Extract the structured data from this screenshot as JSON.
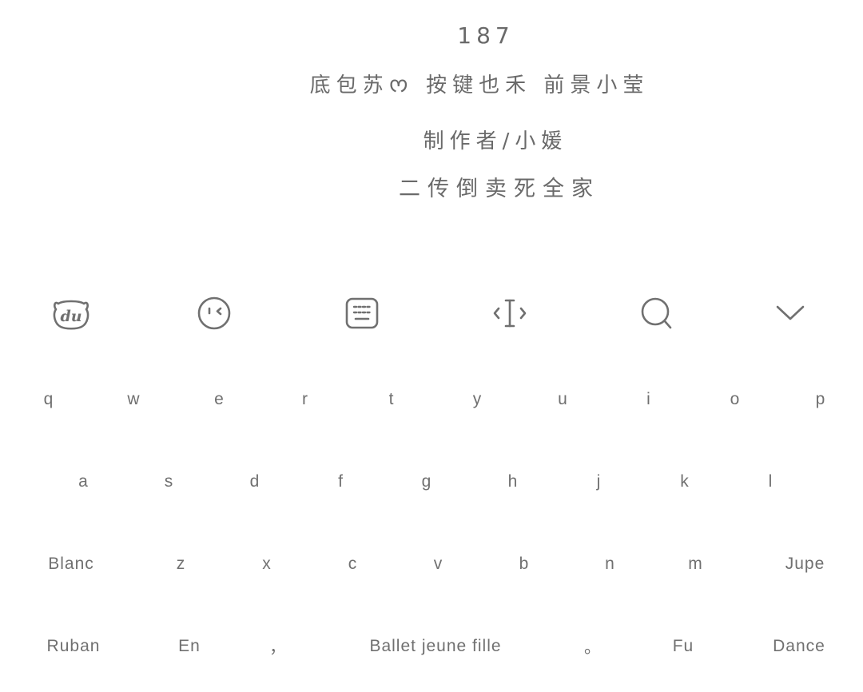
{
  "header": {
    "number": "187",
    "credits": "底包苏ᰔ 按键也禾 前景小莹",
    "author": "制作者/小媛",
    "note": "二传倒卖死全家"
  },
  "toolbar": {
    "items": [
      {
        "icon": "du-bear-logo-icon"
      },
      {
        "icon": "emoji-face-icon"
      },
      {
        "icon": "keyboard-layout-icon"
      },
      {
        "icon": "cursor-move-icon"
      },
      {
        "icon": "search-icon"
      },
      {
        "icon": "chevron-down-icon"
      }
    ]
  },
  "keyboard": {
    "row1": [
      "q",
      "w",
      "e",
      "r",
      "t",
      "y",
      "u",
      "i",
      "o",
      "p"
    ],
    "row2": [
      "a",
      "s",
      "d",
      "f",
      "g",
      "h",
      "j",
      "k",
      "l"
    ],
    "row3": {
      "left": "Blanc",
      "letters": [
        "z",
        "x",
        "c",
        "v",
        "b",
        "n",
        "m"
      ],
      "right": "Jupe"
    },
    "row4": {
      "left": "Ruban",
      "lang": "En",
      "comma": "，",
      "space": "Ballet jeune fille",
      "period": "。",
      "fu": "Fu",
      "right": "Dance"
    }
  },
  "colors": {
    "background": "#ffffff",
    "text": "#6e6e6e",
    "icon": "#707070"
  }
}
